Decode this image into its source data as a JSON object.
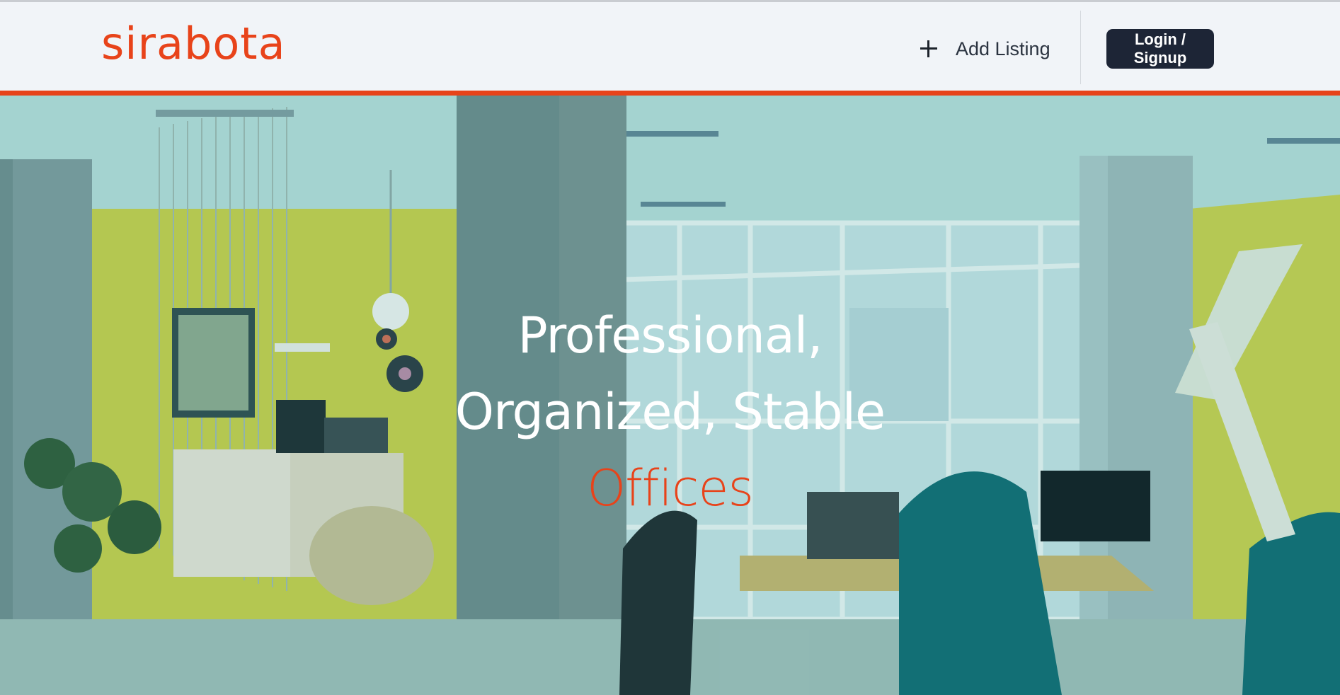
{
  "header": {
    "logo_text": "sirabota",
    "add_listing_label": "Add Listing",
    "login_label": "Login / Signup",
    "add_icon": "plus-icon"
  },
  "hero": {
    "line1": "Professional,",
    "line2": "Organized, Stable",
    "accent_word": "Offices"
  },
  "colors": {
    "brand": "#e8431a",
    "button_bg": "#1d2536",
    "header_bg": "#f1f4f8"
  }
}
